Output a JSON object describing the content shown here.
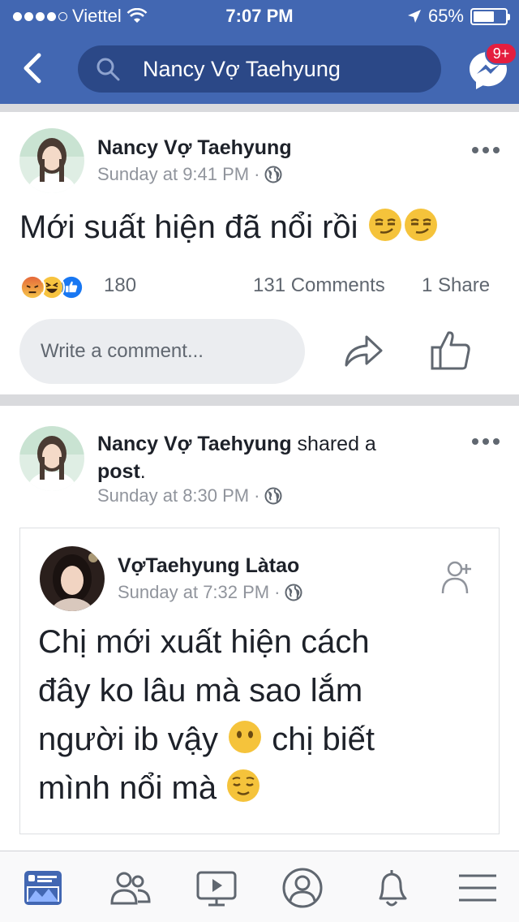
{
  "status_bar": {
    "carrier": "Viettel",
    "time": "7:07 PM",
    "battery": "65%"
  },
  "nav": {
    "search_text": "Nancy Vợ Taehyung",
    "messenger_badge": "9+"
  },
  "post1": {
    "author": "Nancy Vợ Taehyung",
    "time": "Sunday at 9:41 PM",
    "text": "Mới suất hiện đã nổi rồi",
    "reaction_count": "180",
    "comments": "131 Comments",
    "shares": "1 Share",
    "comment_placeholder": "Write a comment..."
  },
  "post2": {
    "author": "Nancy Vợ Taehyung",
    "shared_text": " shared a",
    "post_word": "post",
    "time": "Sunday at 8:30 PM",
    "shared_post": {
      "author": "VợTaehyung Làtao",
      "time": "Sunday at 7:32 PM",
      "line1": "Chị mới xuất hiện cách",
      "line2": "đây ko lâu mà sao lắm",
      "line3": "người ib vậy",
      "line3b": "chị biết",
      "line4": "mình nổi mà"
    }
  },
  "colors": {
    "brand": "#4267b2",
    "search_bg": "#2b4887",
    "badge": "#e41e3f",
    "like": "#1877f2"
  }
}
